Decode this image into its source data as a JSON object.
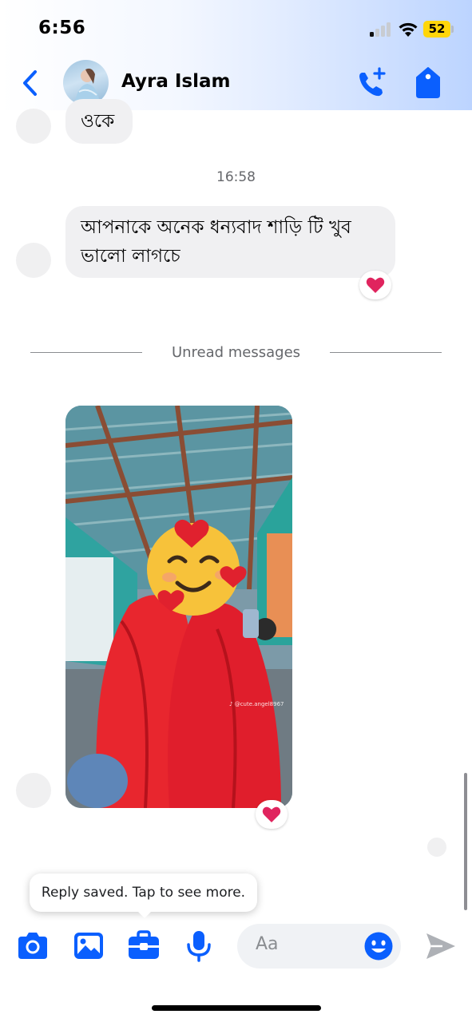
{
  "status_bar": {
    "time": "6:56",
    "battery": "52"
  },
  "header": {
    "contact_name": "Ayra Islam"
  },
  "messages": [
    {
      "text": "ওকে"
    },
    {
      "text_line1": "আপনাকে অনেক ধন্যবাদ শাড়ি টি খুব",
      "text_line2": "ভালো লাগচে",
      "reaction": "❤️"
    }
  ],
  "timestamp": "16:58",
  "unread_label": "Unread messages",
  "photo_message": {
    "reaction": "❤️",
    "watermark": "♪ @cute.angel8967"
  },
  "toast": {
    "text": "Reply saved. Tap to see more."
  },
  "composer": {
    "placeholder": "Aa"
  },
  "colors": {
    "accent": "#0a5ffe",
    "heart": "#e0245e",
    "bubble": "#f0f0f2"
  }
}
